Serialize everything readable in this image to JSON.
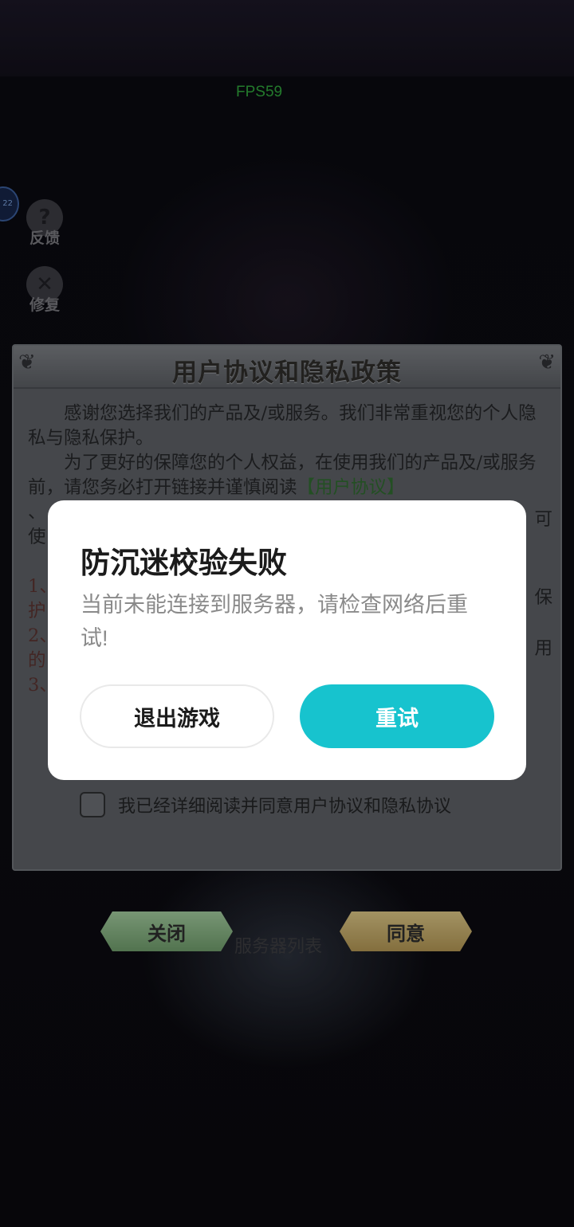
{
  "overlay": {
    "fps": "FPS59",
    "edge_badge": "22"
  },
  "side_buttons": {
    "feedback": {
      "icon": "question-icon",
      "glyph": "?",
      "label": "反馈"
    },
    "repair": {
      "icon": "wrench-icon",
      "glyph": "✕",
      "label": "修复"
    }
  },
  "agreement": {
    "title": "用户协议和隐私政策",
    "para1": "感谢您选择我们的产品及/或服务。我们非常重视您的个人隐私与隐私保护。",
    "para2_prefix": "为了更好的保障您的个人权益，在使用我们的产品及/或服务前，请您务必打开链接并谨慎阅读",
    "para2_link": "【用户协议】",
    "line_sep": "、",
    "line_use": "使",
    "clause1_start": "1、",
    "clause1_cont": "护",
    "clause2_start": "2、",
    "clause2_cont": "的",
    "clause3_start": "3、",
    "right_cut_1": "可",
    "right_cut_2": "保",
    "right_cut_3": "用",
    "checkbox_checked": false,
    "checkbox_label": "我已经详细阅读并同意用户协议和隐私协议"
  },
  "game_buttons": {
    "close": "关闭",
    "agree": "同意",
    "server_list": "服务器列表"
  },
  "dialog": {
    "title": "防沉迷校验失败",
    "message": "当前未能连接到服务器，请检查网络后重试!",
    "exit_label": "退出游戏",
    "retry_label": "重试",
    "accent_color": "#17c3ce"
  }
}
